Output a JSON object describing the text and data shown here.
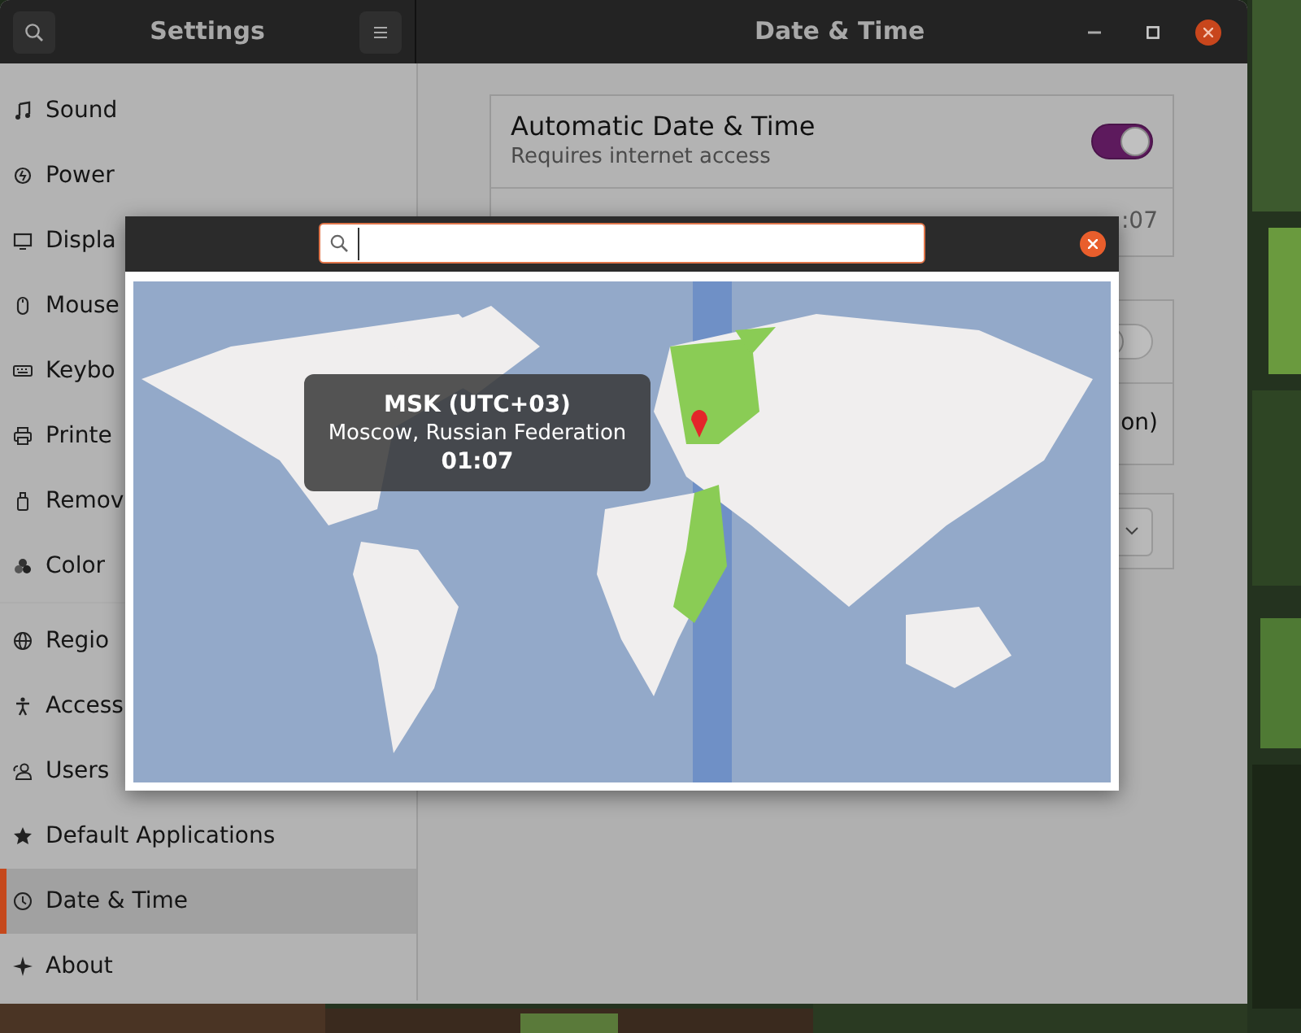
{
  "settings_window": {
    "sidebar_title": "Settings",
    "panel_title": "Date & Time"
  },
  "sidebar": {
    "groups": [
      [
        {
          "label": "Sound",
          "selected": false
        },
        {
          "label": "Power",
          "selected": false
        },
        {
          "label": "Displa",
          "selected": false
        },
        {
          "label": "Mouse",
          "selected": false
        },
        {
          "label": "Keybo",
          "selected": false
        },
        {
          "label": "Printe",
          "selected": false
        },
        {
          "label": "Remov",
          "selected": false
        },
        {
          "label": "Color",
          "selected": false
        }
      ],
      [
        {
          "label": "Regio",
          "selected": false
        },
        {
          "label": "Access",
          "selected": false
        },
        {
          "label": "Users",
          "selected": false
        },
        {
          "label": "Default Applications",
          "selected": false
        },
        {
          "label": "Date & Time",
          "selected": true
        },
        {
          "label": "About",
          "selected": false
        }
      ]
    ]
  },
  "panel": {
    "automatic_date_time": {
      "label": "Automatic Date & Time",
      "sublabel": "Requires internet access",
      "on": true
    },
    "date_time_value": ":07",
    "second_card": {
      "toggle_on": false,
      "row_text": "on)"
    }
  },
  "timezone_dialog": {
    "tooltip": {
      "zone": "MSK (UTC+03)",
      "city": "Moscow, Russian Federation",
      "time": "01:07"
    }
  }
}
